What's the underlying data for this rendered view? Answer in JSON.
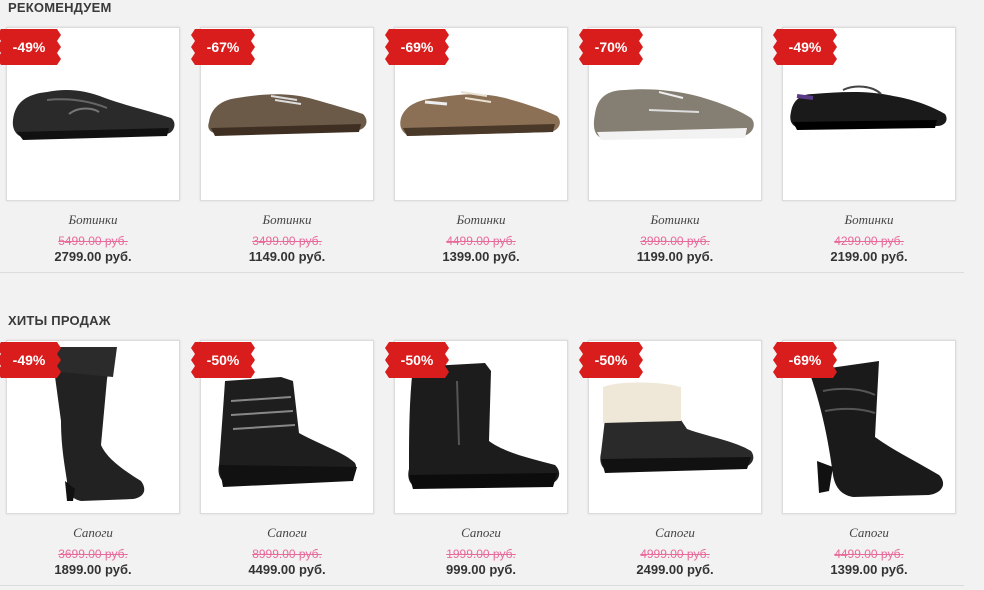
{
  "sections": [
    {
      "title": "РЕКОМЕНДУЕМ",
      "products": [
        {
          "discount": "-49%",
          "name": "Ботинки",
          "old_price": "5499.00 руб.",
          "price": "2799.00 руб.",
          "image": "black-sneaker-shoe",
          "color": "#2a2a2a"
        },
        {
          "discount": "-67%",
          "name": "Ботинки",
          "old_price": "3499.00 руб.",
          "price": "1149.00 руб.",
          "image": "brown-derby-shoe",
          "color": "#6b5a47"
        },
        {
          "discount": "-69%",
          "name": "Ботинки",
          "old_price": "4499.00 руб.",
          "price": "1399.00 руб.",
          "image": "tan-derby-shoe",
          "color": "#8c7056"
        },
        {
          "discount": "-70%",
          "name": "Ботинки",
          "old_price": "3999.00 руб.",
          "price": "1199.00 руб.",
          "image": "grey-boat-shoe",
          "color": "#857e72"
        },
        {
          "discount": "-49%",
          "name": "Ботинки",
          "old_price": "4299.00 руб.",
          "price": "2199.00 руб.",
          "image": "black-loafer-shoe",
          "color": "#1a1a1a"
        }
      ]
    },
    {
      "title": "ХИТЫ ПРОДАЖ",
      "products": [
        {
          "discount": "-49%",
          "name": "Сапоги",
          "old_price": "3699.00 руб.",
          "price": "1899.00 руб.",
          "image": "black-knee-high-boot",
          "color": "#222222"
        },
        {
          "discount": "-50%",
          "name": "Сапоги",
          "old_price": "8999.00 руб.",
          "price": "4499.00 руб.",
          "image": "black-hiking-boot",
          "color": "#1e1e1e"
        },
        {
          "discount": "-50%",
          "name": "Сапоги",
          "old_price": "1999.00 руб.",
          "price": "999.00 руб.",
          "image": "black-leather-boot",
          "color": "#1c1c1c"
        },
        {
          "discount": "-50%",
          "name": "Сапоги",
          "old_price": "4999.00 руб.",
          "price": "2499.00 руб.",
          "image": "black-fur-lined-boot",
          "color": "#2a2a2a"
        },
        {
          "discount": "-69%",
          "name": "Сапоги",
          "old_price": "4499.00 руб.",
          "price": "1399.00 руб.",
          "image": "black-slouch-heel-boot",
          "color": "#1a1a1a"
        }
      ]
    }
  ],
  "badge_color": "#d91c1c"
}
